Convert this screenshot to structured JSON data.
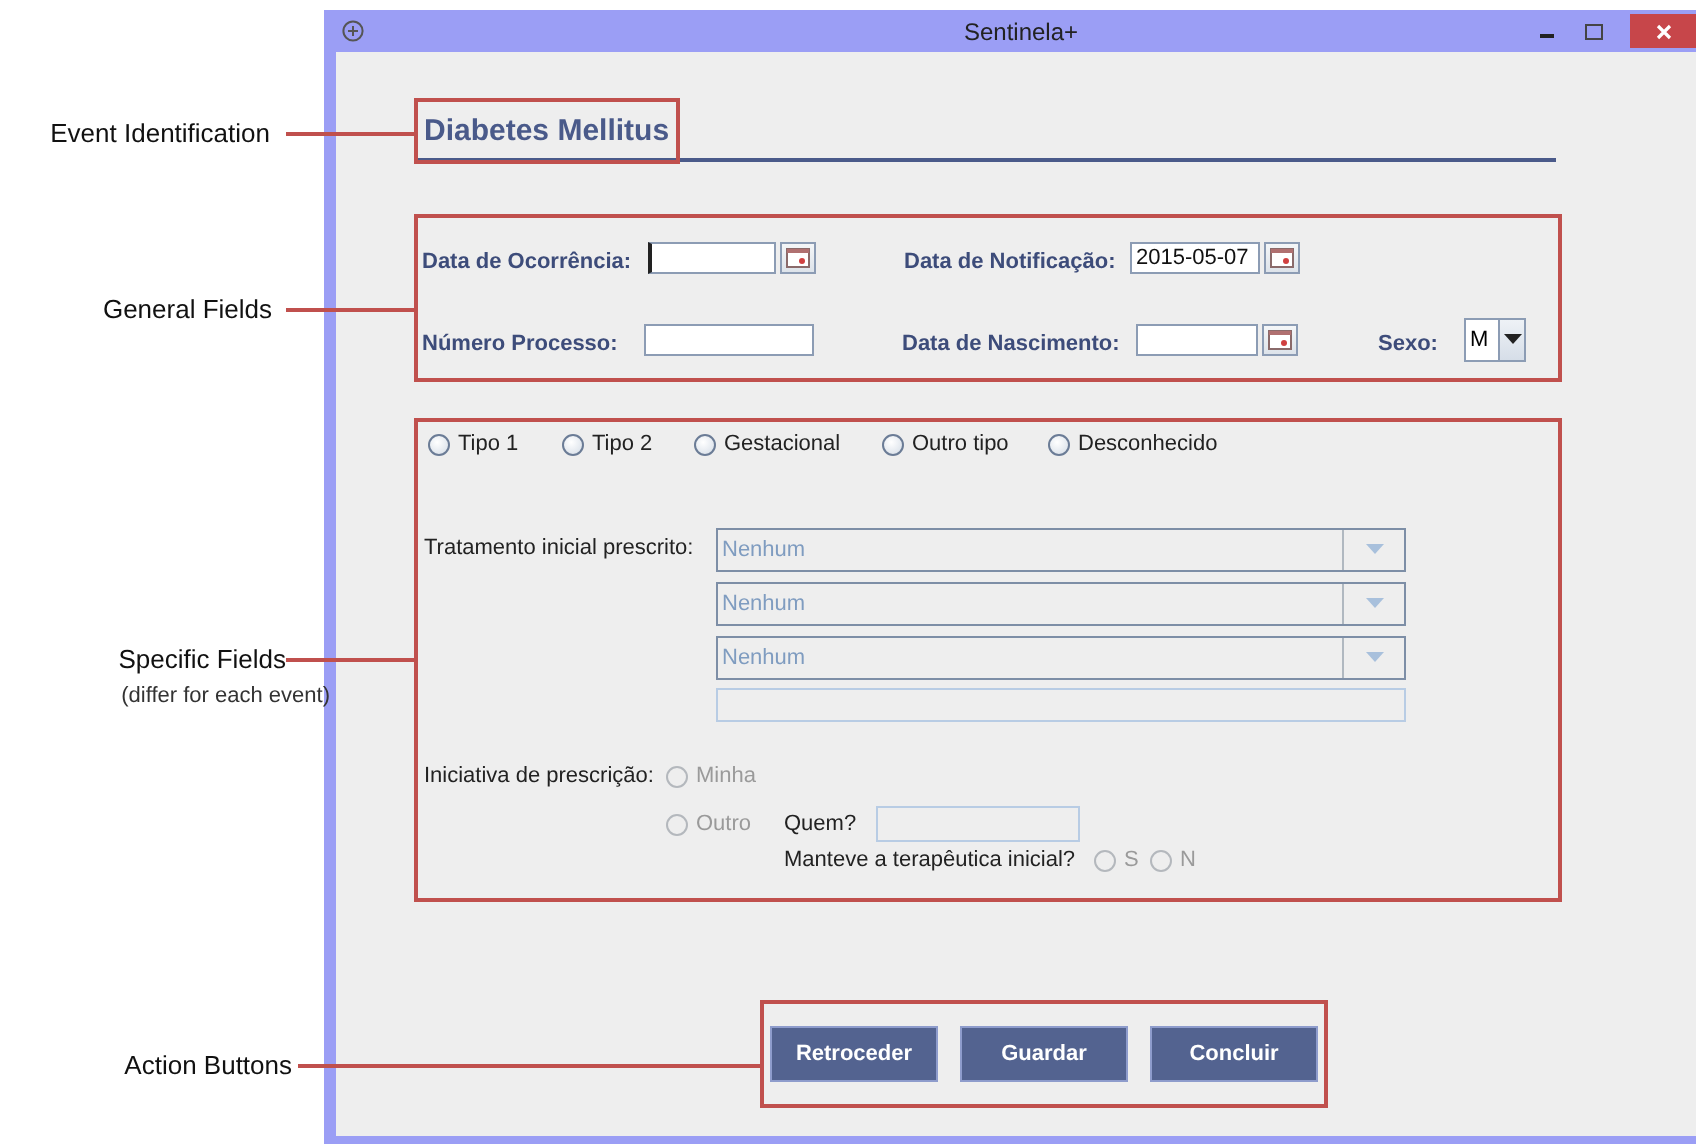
{
  "annotations": [
    {
      "label": "Event Identification"
    },
    {
      "label": "General Fields"
    },
    {
      "label": "Specific Fields",
      "note": "(differ for each event)"
    },
    {
      "label": "Action Buttons"
    }
  ],
  "window": {
    "title": "Sentinela+"
  },
  "event": {
    "title": "Diabetes Mellitus"
  },
  "general_fields": {
    "occurrence_date": {
      "label": "Data de Ocorrência:"
    },
    "notification_date": {
      "label": "Data de Notificação:",
      "value": "2015-05-07"
    },
    "process_number": {
      "label": "Número Processo:"
    },
    "birth_date": {
      "label": "Data de Nascimento:"
    },
    "sex": {
      "label": "Sexo:",
      "value": "M"
    }
  },
  "diabetes_types": [
    {
      "label": "Tipo 1",
      "selected": false
    },
    {
      "label": "Tipo 2",
      "selected": false
    },
    {
      "label": "Gestacional",
      "selected": false
    },
    {
      "label": "Outro tipo",
      "selected": false
    },
    {
      "label": "Desconhecido",
      "selected": false
    }
  ],
  "treatment": {
    "label": "Tratamento inicial prescrito:",
    "selects": [
      {
        "value": "Nenhum",
        "disabled": true
      },
      {
        "value": "Nenhum",
        "disabled": true
      },
      {
        "value": "Nenhum",
        "disabled": true
      }
    ]
  },
  "initiative": {
    "label": "Iniciativa de prescrição:",
    "options": [
      {
        "label": "Minha",
        "selected": false,
        "disabled": true
      },
      {
        "label": "Outro",
        "selected": false,
        "disabled": true
      }
    ],
    "who": {
      "label": "Quem?"
    },
    "kept": {
      "label": "Manteve a terapêutica inicial?",
      "options": [
        {
          "label": "S",
          "selected": false,
          "disabled": true
        },
        {
          "label": "N",
          "selected": false,
          "disabled": true
        }
      ]
    }
  },
  "buttons": [
    {
      "label": "Retroceder"
    },
    {
      "label": "Guardar"
    },
    {
      "label": "Concluir"
    }
  ]
}
